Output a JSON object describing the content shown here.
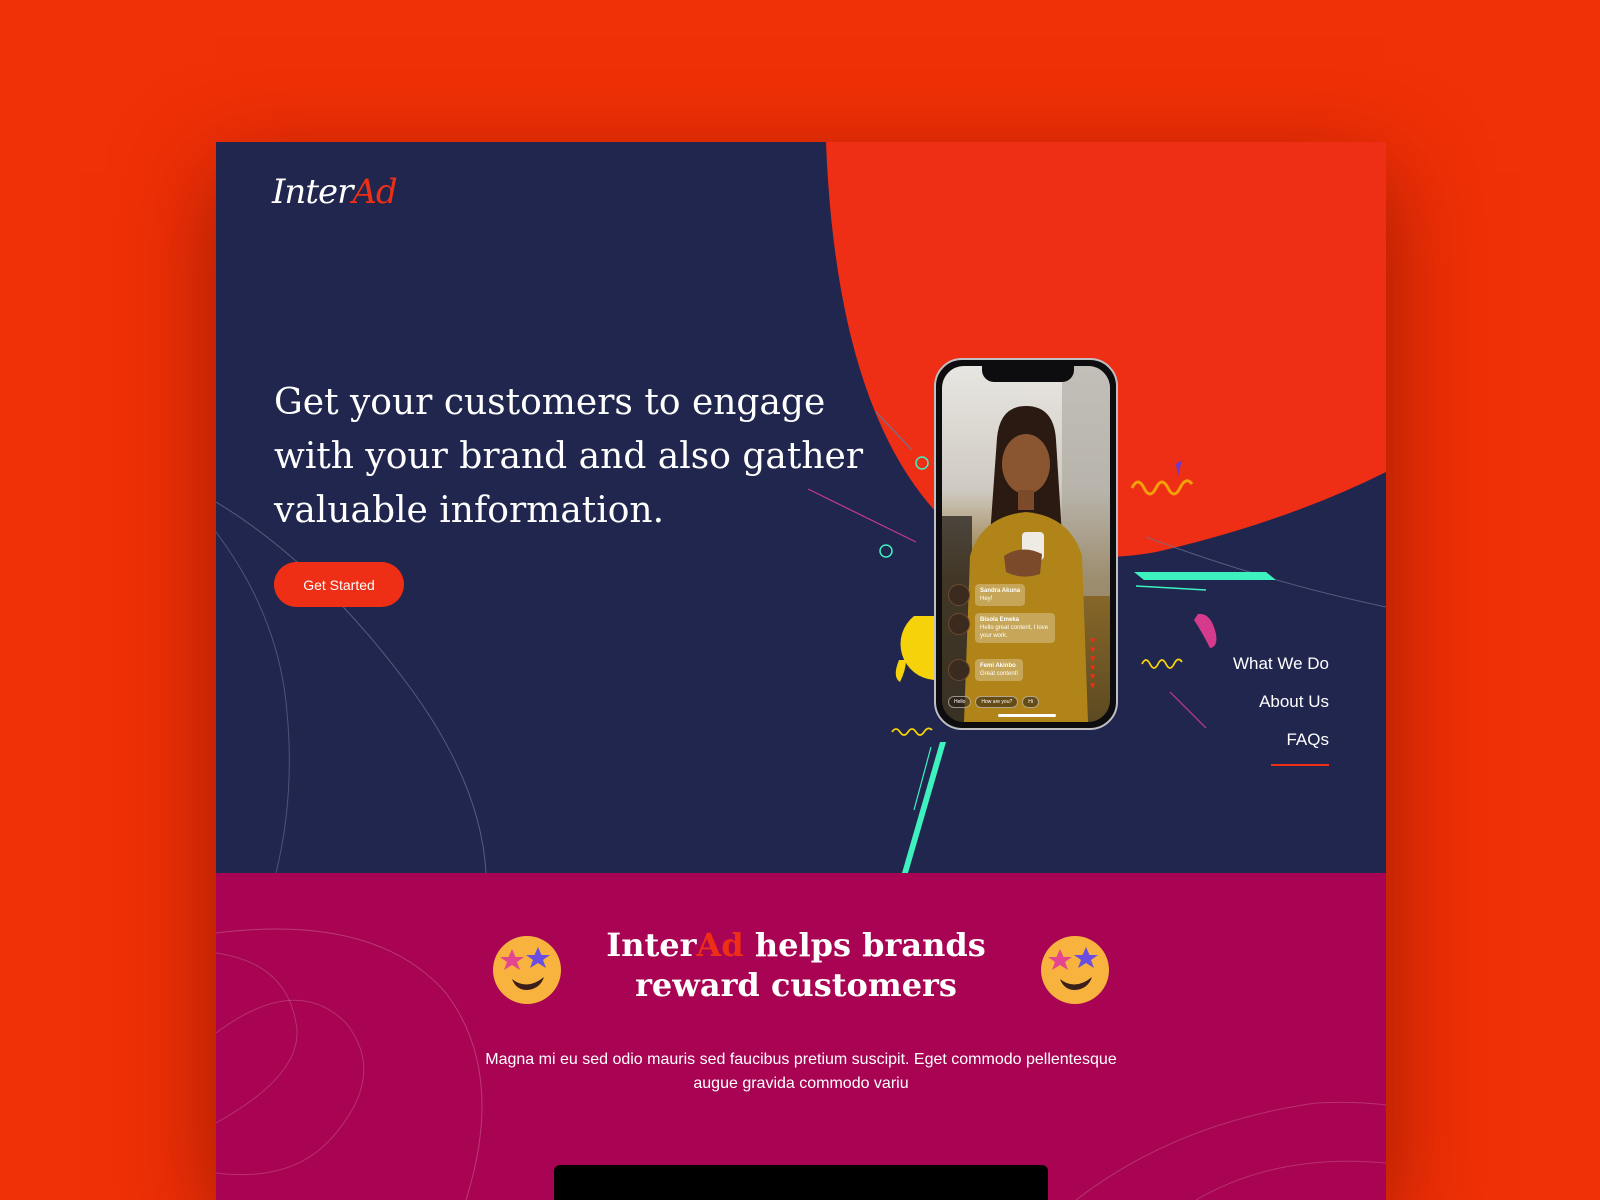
{
  "brand": {
    "name_part1": "Inter",
    "name_part2": "Ad"
  },
  "hero": {
    "headline": "Get your customers to engage with your brand and also gather valuable information.",
    "cta_label": "Get Started"
  },
  "nav": {
    "items": [
      {
        "label": "What We Do"
      },
      {
        "label": "About Us"
      },
      {
        "label": "FAQs"
      }
    ],
    "active": "FAQs"
  },
  "phone": {
    "comments": [
      {
        "name": "Sandra Akuna",
        "text": "Hey!"
      },
      {
        "name": "Bisola Emeka",
        "text": "Hello great content, I love your work."
      },
      {
        "name": "Femi Akinbo",
        "text": "Great content!"
      }
    ],
    "quick_replies": [
      "Hello",
      "How are you?",
      "Hi"
    ]
  },
  "section": {
    "title_brand_part1": "Inter",
    "title_brand_part2": "Ad",
    "title_rest": " helps brands reward customers",
    "body": "Magna mi eu sed odio mauris sed faucibus pretium suscipit. Eget commodo pellentesque augue gravida commodo variu"
  },
  "colors": {
    "page_bg": "#f03006",
    "hero_bg": "#20264d",
    "accent": "#ee2f15",
    "section_bg": "#a80453",
    "teal": "#3ef2c0",
    "yellow": "#f5d20a"
  },
  "icons": [
    "star-struck-emoji-icon"
  ]
}
